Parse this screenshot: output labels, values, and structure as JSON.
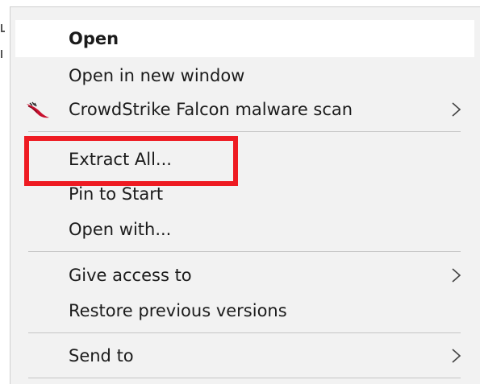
{
  "menu": {
    "items": [
      {
        "label": "Open",
        "bold": true
      },
      {
        "label": "Open in new window"
      },
      {
        "label": "CrowdStrike Falcon malware scan",
        "icon": "falcon-icon",
        "submenu": true
      },
      {
        "label": "Extract All...",
        "highlighted": true
      },
      {
        "label": "Pin to Start"
      },
      {
        "label": "Open with..."
      },
      {
        "label": "Give access to",
        "submenu": true
      },
      {
        "label": "Restore previous versions"
      },
      {
        "label": "Send to",
        "submenu": true
      }
    ]
  },
  "colors": {
    "menu_bg": "#f2f2f2",
    "hover_bg": "#ffffff",
    "separator": "#c5c5c5",
    "highlight": "#ee1b22",
    "text": "#1b1b1b"
  }
}
